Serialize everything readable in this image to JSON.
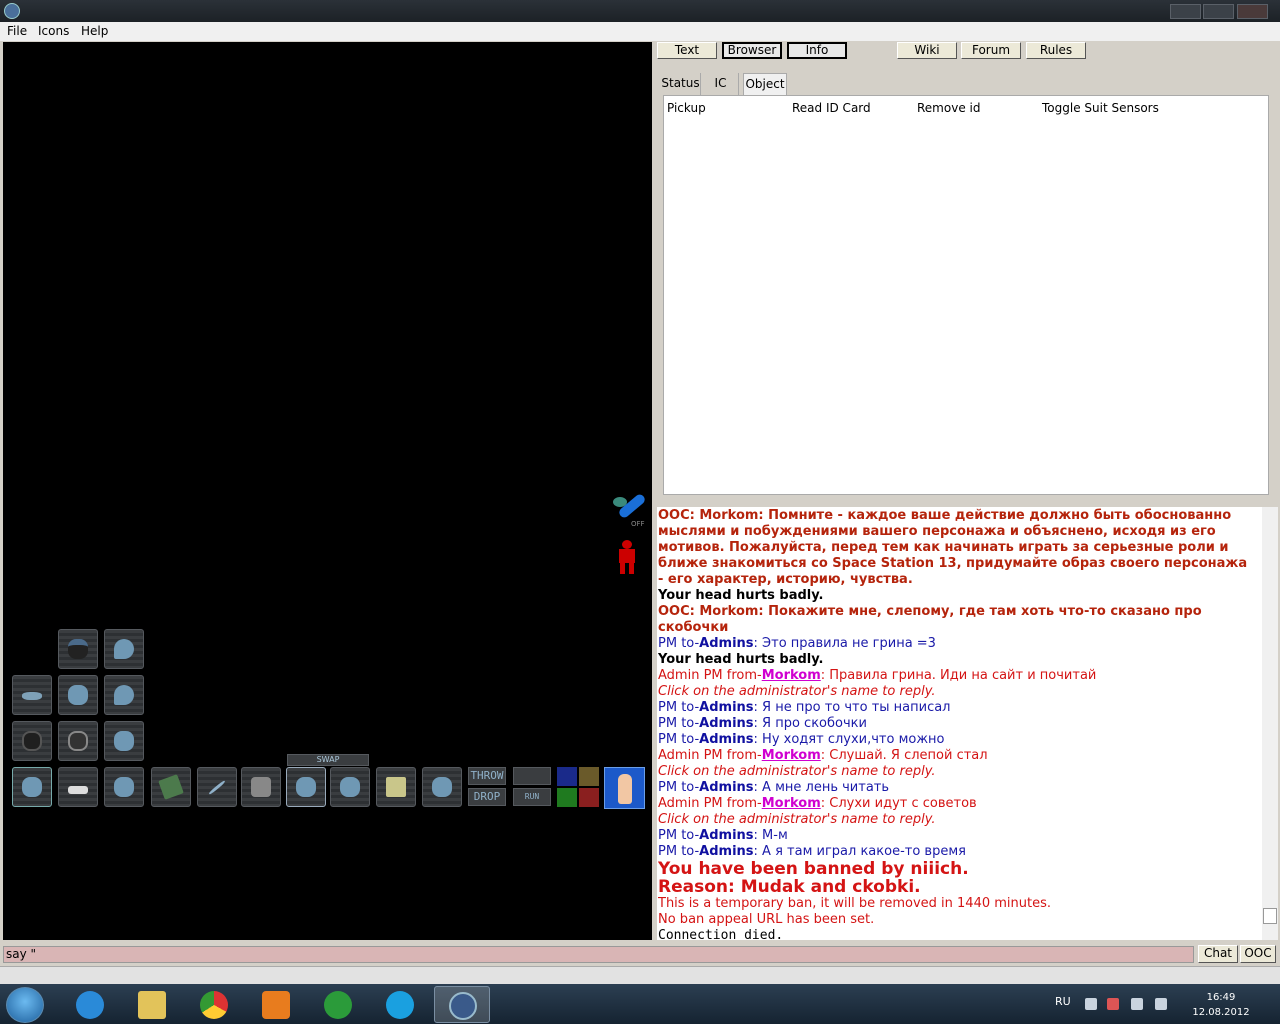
{
  "menu": {
    "items": [
      "File",
      "Icons",
      "Help"
    ]
  },
  "top_buttons": [
    "Text",
    "Browser",
    "Info",
    "Wiki",
    "Forum",
    "Rules"
  ],
  "stat_tabs": [
    "Status",
    "IC",
    "Object"
  ],
  "verbs": [
    "Pickup",
    "Read ID Card",
    "Remove id",
    "Toggle Suit Sensors"
  ],
  "hud": {
    "swap": "SWAP",
    "throw": "THROW",
    "drop": "DROP",
    "run": "RUN",
    "internals_off": "OFF"
  },
  "output": {
    "ooc1": "OOC: Morkom: Помните - каждое ваше действие должно быть обоснованно мыслями и побуждениями вашего персонажа и объяснено, исходя из его мотивов. Пожалуйста, перед тем как начинать играть за серьезные роли и ближе знакомиться со Space Station 13, придумайте образ своего персонажа - его характер, историю, чувства.",
    "head1": "Your head hurts badly.",
    "ooc2": "OOC: Morkom: Покажите мне, слепому, где там хоть что-то сказано про скобочки",
    "pm_prefix": "PM to-",
    "admins": "Admins",
    "apm_prefix": "Admin PM from-",
    "morkom": "Morkom",
    "pm1": ": Это правила не грина =3",
    "head2": "Your head hurts badly.",
    "apm1": ": Правила грина. Иди на сайт и почитай",
    "reply": "Click on the administrator's name to reply.",
    "pm2": ": Я не про то что ты написал",
    "pm3": ": Я про скобочки",
    "pm4": ": Ну ходят слухи,что можно",
    "apm2": ": Слушай. Я слепой стал",
    "pm5": ": А мне лень читать",
    "apm3": ": Слухи идут с советов",
    "pm6": ": М-м",
    "pm7": ": А я там играл какое-то время",
    "ban1": "You have been banned by niiich.",
    "ban2": "Reason: Mudak and ckobki.",
    "temp": "This is a temporary ban, it will be removed in 1440 minutes.",
    "appeal": "No ban appeal URL has been set.",
    "died": "Connection died."
  },
  "input": {
    "value": "say \"",
    "chat": "Chat",
    "ooc": "OOC"
  },
  "taskbar": {
    "apps": [
      "start-orb",
      "internet-explorer-icon",
      "file-explorer-icon",
      "chrome-icon",
      "media-player-icon",
      "utorrent-icon",
      "skype-icon",
      "ss13-icon"
    ],
    "lang": "RU",
    "time": "16:49",
    "date": "12.08.2012"
  },
  "colors": {
    "ooc": "#b5240c",
    "pm": "#1a1aa8",
    "admin_pm": "#d41414",
    "admin_link": "#d000d0"
  }
}
